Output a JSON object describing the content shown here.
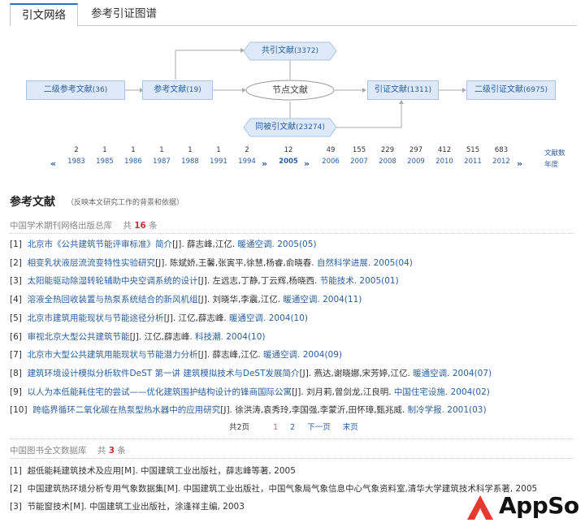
{
  "tabs": [
    {
      "label": "引文网络",
      "active": true
    },
    {
      "label": "参考引证图谱",
      "active": false
    }
  ],
  "diagram": {
    "secondary_refs": {
      "label": "二级参考文献",
      "count": "(36)"
    },
    "refs": {
      "label": "参考文献",
      "count": "(19)"
    },
    "co_cited": {
      "label": "共引文献",
      "count": "(3372)"
    },
    "node": {
      "label": "节点文献"
    },
    "co_citing": {
      "label": "同被引文献",
      "count": "(23274)"
    },
    "citing": {
      "label": "引证文献",
      "count": "(1311)"
    },
    "secondary_citing": {
      "label": "二级引证文献",
      "count": "(6975)"
    }
  },
  "timeline": {
    "left_chev": "«",
    "mid_chev": "»",
    "right_chev": "»",
    "legend_count": "文献数",
    "legend_year": "年度",
    "left": [
      {
        "count": "2",
        "year": "1983"
      },
      {
        "count": "1",
        "year": "1985"
      },
      {
        "count": "1",
        "year": "1986"
      },
      {
        "count": "1",
        "year": "1987"
      },
      {
        "count": "1",
        "year": "1988"
      },
      {
        "count": "1",
        "year": "1991"
      },
      {
        "count": "2",
        "year": "1994"
      }
    ],
    "current": {
      "count": "12",
      "year": "2005"
    },
    "right": [
      {
        "count": "49",
        "year": "2006"
      },
      {
        "count": "155",
        "year": "2007"
      },
      {
        "count": "229",
        "year": "2008"
      },
      {
        "count": "297",
        "year": "2009"
      },
      {
        "count": "412",
        "year": "2010"
      },
      {
        "count": "515",
        "year": "2011"
      },
      {
        "count": "683",
        "year": "2012"
      }
    ]
  },
  "section": {
    "title": "参考文献",
    "subtitle": "（反映本文研究工作的背景和依据）"
  },
  "db1": {
    "name": "中国学术期刊网络出版总库",
    "count_prefix": "共",
    "count": "16",
    "count_suffix": "条"
  },
  "refs1": [
    {
      "idx": "[1]",
      "title": "北京市《公共建筑节能评审标准》简介",
      "meta": "[J]. 薛志峰,江亿.",
      "journal": "暖通空调.",
      "year": "2005(05)"
    },
    {
      "idx": "[2]",
      "title": "相变乳状液层流流变特性实验研究",
      "meta": "[J]. 陈斌娇,王馨,张寅平,徐慧,杨睿,俞晓春.",
      "journal": "自然科学进展.",
      "year": "2005(04)"
    },
    {
      "idx": "[3]",
      "title": "太阳能驱动除湿转轮辅助中央空调系统的设计",
      "meta": "[J]. 左远志,丁静,丁云辉,杨晓西.",
      "journal": "节能技术.",
      "year": "2005(01)"
    },
    {
      "idx": "[4]",
      "title": "溶液全热回收装置与热泵系统结合的新风机组",
      "meta": "[J]. 刘晓华,李震,江亿.",
      "journal": "暖通空调.",
      "year": "2004(11)"
    },
    {
      "idx": "[5]",
      "title": "北京市建筑用能现状与节能途径分析",
      "meta": "[J]. 江亿,薛志峰.",
      "journal": "暖通空调.",
      "year": "2004(10)"
    },
    {
      "idx": "[6]",
      "title": "审视北京大型公共建筑节能",
      "meta": "[J]. 江亿,薛志峰.",
      "journal": "科技潮.",
      "year": "2004(10)"
    },
    {
      "idx": "[7]",
      "title": "北京市大型公共建筑用能现状与节能潜力分析",
      "meta": "[J]. 薛志峰,江亿.",
      "journal": "暖通空调.",
      "year": "2004(09)"
    },
    {
      "idx": "[8]",
      "title": "建筑环境设计模拟分析软件DeST 第一讲 建筑模拟技术与DeST发展简介",
      "meta": "[J]. 燕达,谢晓娜,宋芳婷,江亿.",
      "journal": "暖通空调.",
      "year": "2004(07)"
    },
    {
      "idx": "[9]",
      "title": "以人为本低能耗住宅的尝试——优化建筑围护结构设计的锋商国际公寓",
      "meta": "[J]. 刘月莉,曾剑龙,江良明.",
      "journal": "中国住宅设施.",
      "year": "2004(02)"
    },
    {
      "idx": "[10]",
      "title": "跨临界循环二氧化碳在热泵型热水器中的应用研究",
      "meta": "[J]. 徐洪涛,袁秀玲,李国强,李蒙沂,田怀璋,甄兆威.",
      "journal": "制冷学报.",
      "year": "2001(03)"
    }
  ],
  "pager": {
    "total": "共2页",
    "page1": "1",
    "page2": "2",
    "next": "下一页",
    "last": "末页"
  },
  "db2": {
    "name": "中国图书全文数据库",
    "count_prefix": "共",
    "count": "3",
    "count_suffix": "条"
  },
  "refs2": [
    {
      "idx": "[1]",
      "text": "超低能耗建筑技术及应用[M]. 中国建筑工业出版社，薛志峰等著, 2005"
    },
    {
      "idx": "[2]",
      "text": "中国建筑热环境分析专用气象数据集[M]. 中国建筑工业出版社，中国气象局气象信息中心气象资料室,清华大学建筑技术科学系著, 2005"
    },
    {
      "idx": "[3]",
      "text": "节能窗技术[M]. 中国建筑工业出版社，涂逢祥主编, 2003"
    }
  ],
  "logo": {
    "text": "AppSo",
    "color": "#e8392e"
  }
}
